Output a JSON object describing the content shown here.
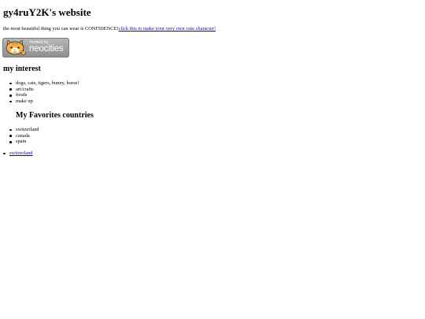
{
  "site": {
    "title": "gy4ruY2K's website",
    "tagline_text": "the most beautiful thing you can wear is CONFIDENCE!",
    "tagline_link": "click this to make your very own cute character!"
  },
  "badge": {
    "small_text": "hosted by",
    "brand_text": "neocities"
  },
  "interests": {
    "heading": "my interest",
    "items": [
      "dogs, cats, tigers, bunny, horse!",
      "art/crafts",
      "foods",
      "make up"
    ]
  },
  "countries": {
    "heading": "My Favorites countries",
    "items": [
      "switzerland",
      "canada",
      "spain"
    ]
  },
  "links": {
    "items": [
      "switzerland"
    ]
  },
  "colors": {
    "link": "#0000ee",
    "text": "#000000",
    "background": "#ffffff",
    "badge": "#9e9e9e"
  }
}
